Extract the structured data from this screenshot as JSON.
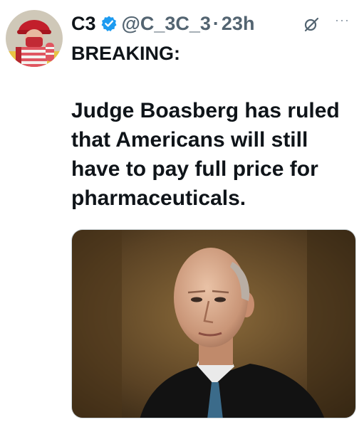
{
  "tweet": {
    "display_name": "C3",
    "handle": "@C_3C_3",
    "separator": "·",
    "time": "23h",
    "more_label": "···",
    "headline": "BREAKING:",
    "body": "Judge Boasberg has ruled that Americans will still have to pay full price for pharmaceuticals.",
    "verified_color": "#1d9bf0"
  },
  "icons": {
    "verified": "verified-badge-icon",
    "grok": "grok-icon",
    "more": "more-options-icon"
  }
}
